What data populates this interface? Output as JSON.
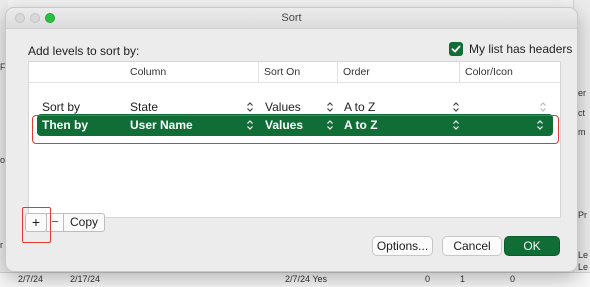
{
  "dialog": {
    "title": "Sort",
    "add_levels_label": "Add levels to sort by:",
    "has_headers_label": "My list has headers",
    "has_headers_checked": true
  },
  "table": {
    "headers": [
      "Column",
      "Sort On",
      "Order",
      "Color/Icon"
    ],
    "rows": [
      {
        "label": "Sort by",
        "column": "State",
        "sort_on": "Values",
        "order": "A to Z",
        "color_icon": ""
      },
      {
        "label": "Then by",
        "column": "User Name",
        "sort_on": "Values",
        "order": "A to Z",
        "color_icon": ""
      }
    ]
  },
  "buttons": {
    "add": "+",
    "remove": "−",
    "copy": "Copy",
    "options": "Options...",
    "cancel": "Cancel",
    "ok": "OK"
  },
  "colors": {
    "accent": "#106d36",
    "highlight_frame": "#e33b2e"
  },
  "background": {
    "right_edge": [
      "er",
      "ct",
      "m",
      "Pr",
      "Le",
      "Le"
    ],
    "left_edge": [
      "Fi",
      "os",
      "r"
    ],
    "bottom_row": [
      "2/7/24",
      "2/17/24",
      "2/7/24 Yes",
      "0",
      "1",
      "0"
    ]
  }
}
